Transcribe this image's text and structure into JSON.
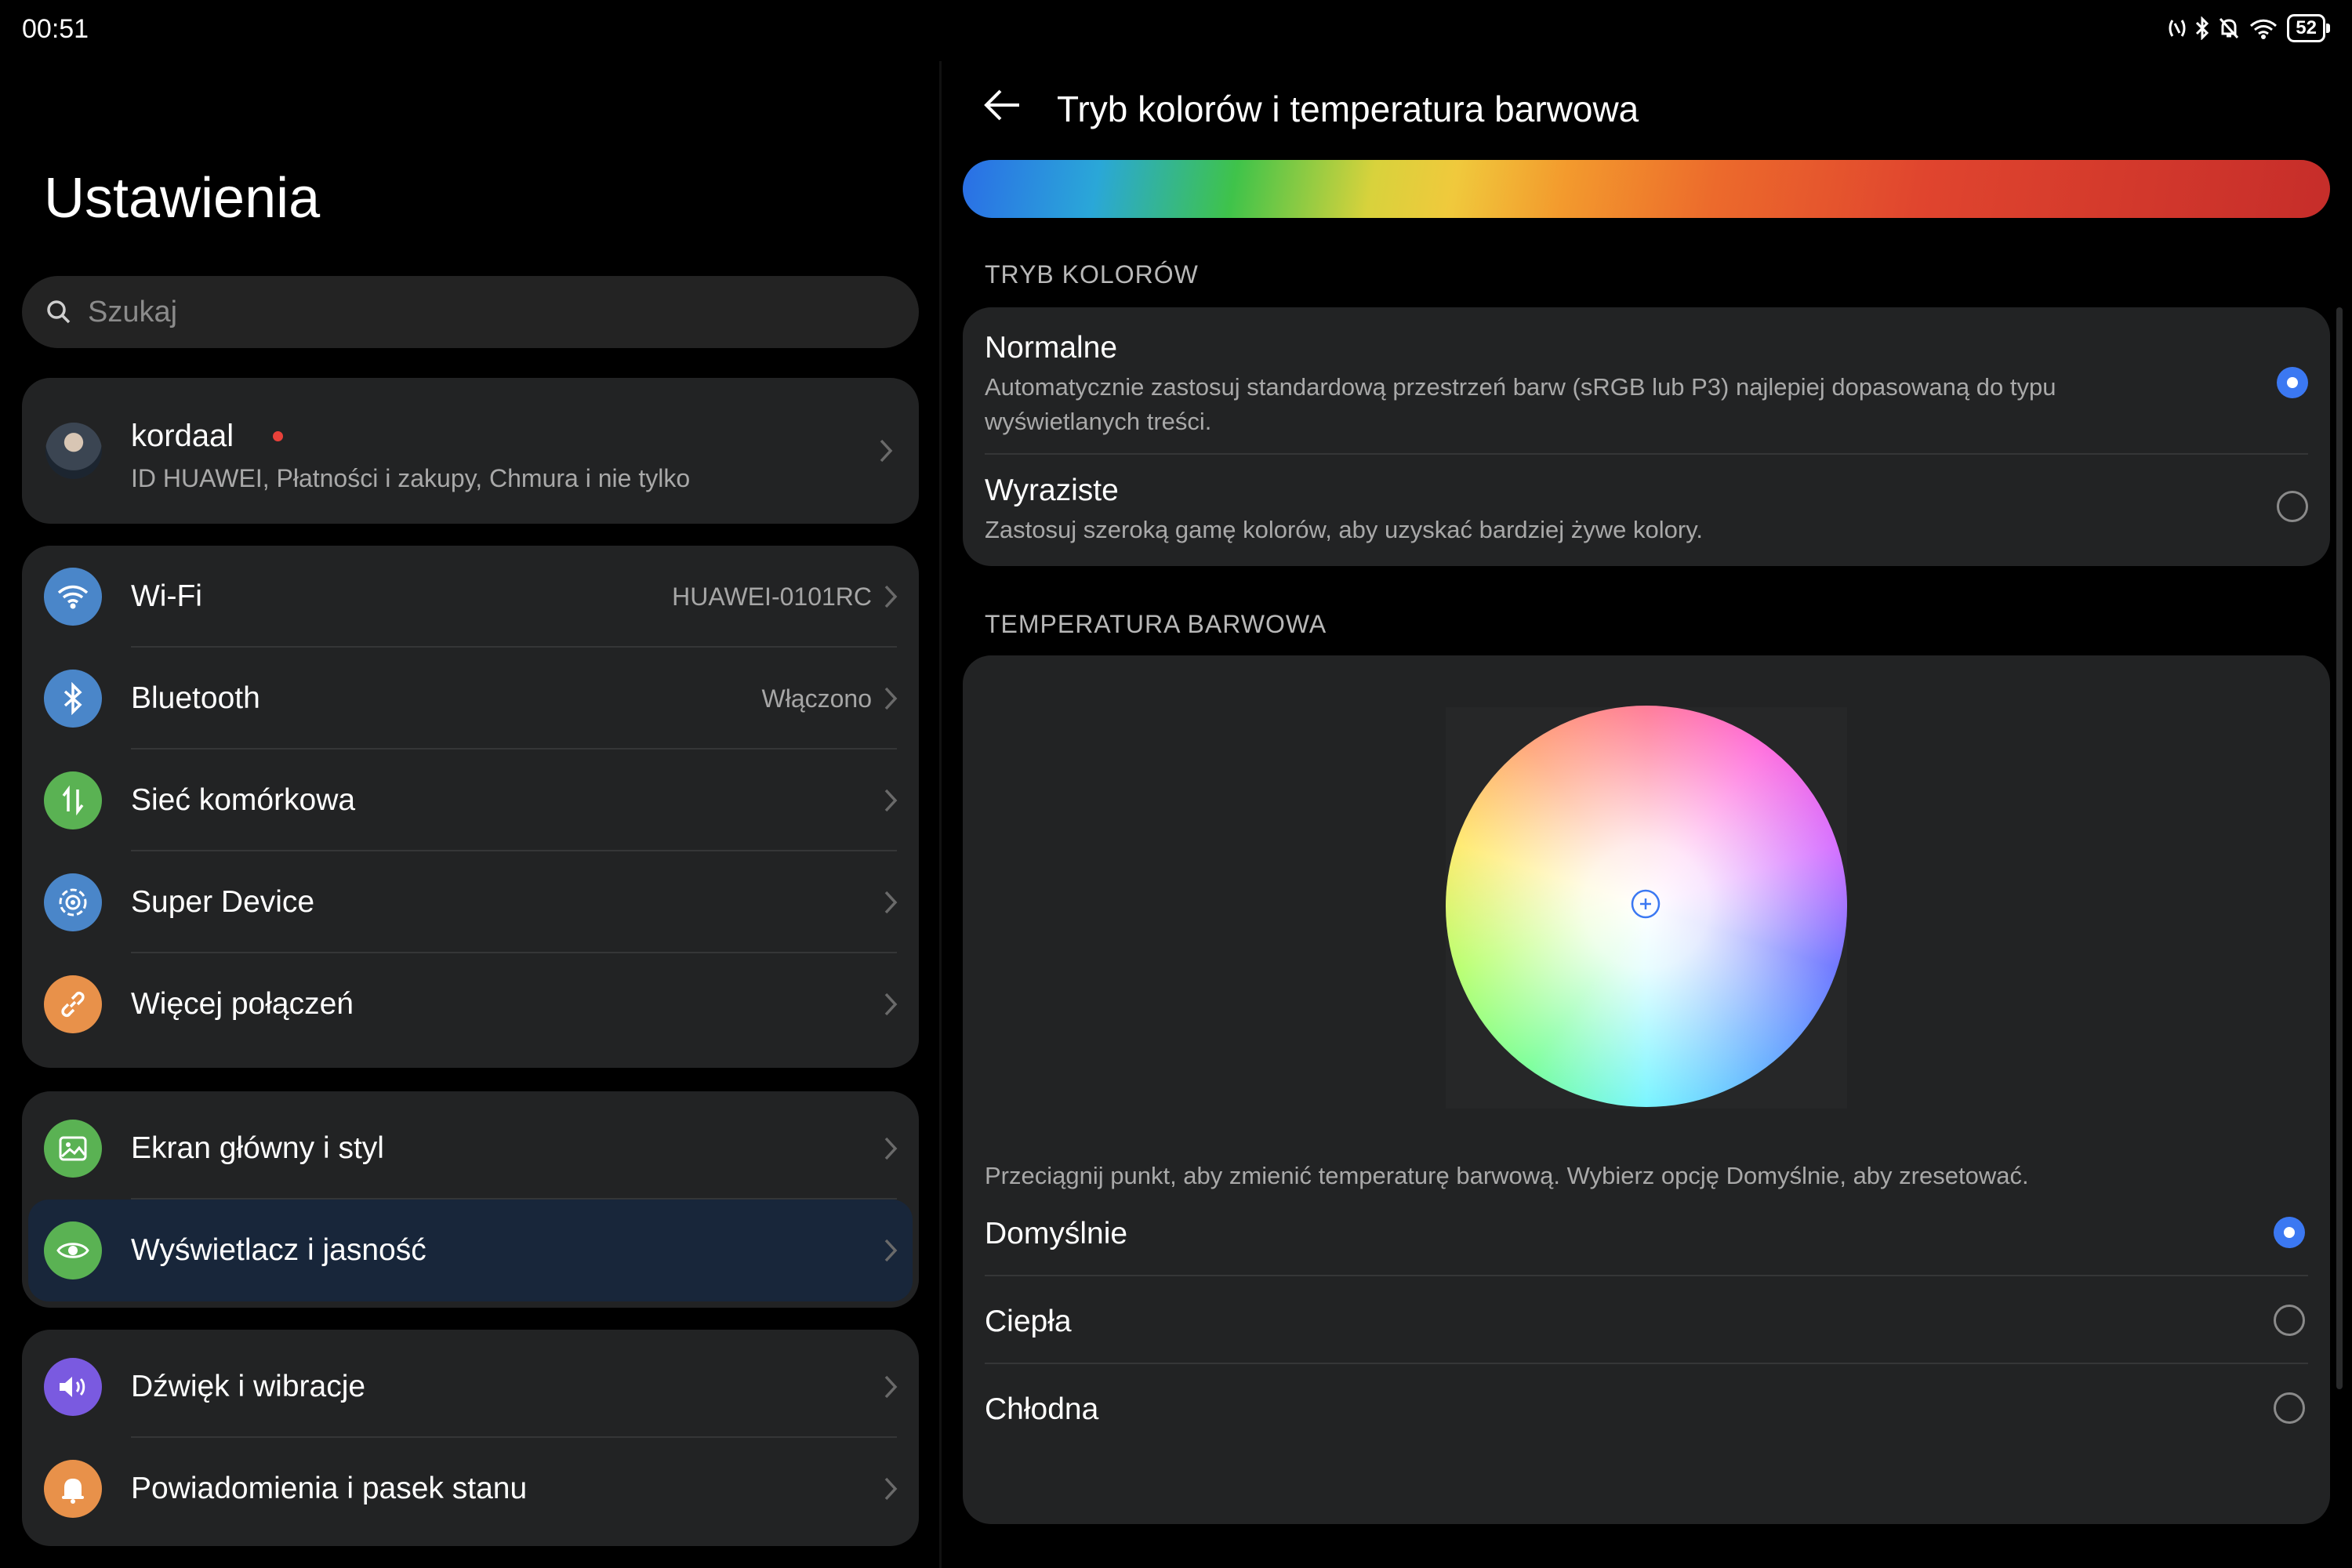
{
  "status_bar": {
    "time": "00:51",
    "battery": "52"
  },
  "settings": {
    "title": "Ustawienia",
    "search_placeholder": "Szukaj",
    "profile": {
      "name": "kordaal",
      "subtitle": "ID HUAWEI, Płatności i zakupy, Chmura i nie tylko"
    },
    "groups": [
      {
        "items": [
          {
            "label": "Wi-Fi",
            "value": "HUAWEI-0101RC",
            "icon": "wifi-icon",
            "color": "#4a86c9"
          },
          {
            "label": "Bluetooth",
            "value": "Włączono",
            "icon": "bluetooth-icon",
            "color": "#4a86c9"
          },
          {
            "label": "Sieć komórkowa",
            "value": "",
            "icon": "mobile-network-icon",
            "color": "#5ab253"
          },
          {
            "label": "Super Device",
            "value": "",
            "icon": "super-device-icon",
            "color": "#4a86c9"
          },
          {
            "label": "Więcej połączeń",
            "value": "",
            "icon": "link-icon",
            "color": "#e8914a"
          }
        ]
      },
      {
        "items": [
          {
            "label": "Ekran główny i styl",
            "value": "",
            "icon": "image-icon",
            "color": "#5ab253"
          },
          {
            "label": "Wyświetlacz i jasność",
            "value": "",
            "icon": "eye-icon",
            "color": "#5ab253",
            "selected": true
          }
        ]
      },
      {
        "items": [
          {
            "label": "Dźwięk i wibracje",
            "value": "",
            "icon": "speaker-icon",
            "color": "#7a5ae0"
          },
          {
            "label": "Powiadomienia i pasek stanu",
            "value": "",
            "icon": "bell-icon",
            "color": "#e8914a"
          }
        ]
      }
    ]
  },
  "detail": {
    "title": "Tryb kolorów i temperatura barwowa",
    "color_mode_header": "TRYB KOLORÓW",
    "color_modes": [
      {
        "title": "Normalne",
        "desc": "Automatycznie zastosuj standardową przestrzeń barw (sRGB lub P3) najlepiej dopasowaną do typu wyświetlanych treści.",
        "selected": true
      },
      {
        "title": "Wyraziste",
        "desc": "Zastosuj szeroką gamę kolorów, aby uzyskać bardziej żywe kolory.",
        "selected": false
      }
    ],
    "temperature_header": "TEMPERATURA BARWOWA",
    "temperature_hint": "Przeciągnij punkt, aby zmienić temperaturę barwową. Wybierz opcję Domyślnie, aby zresetować.",
    "temperature_options": [
      {
        "title": "Domyślnie",
        "selected": true
      },
      {
        "title": "Ciepła",
        "selected": false
      },
      {
        "title": "Chłodna",
        "selected": false
      }
    ],
    "accent_color": "#3b78f2"
  }
}
